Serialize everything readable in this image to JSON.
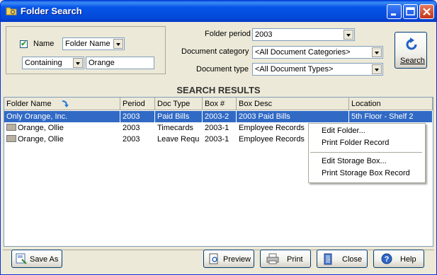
{
  "window": {
    "title": "Folder Search"
  },
  "filters": {
    "name_checkbox_label": "Name",
    "name_checked": true,
    "name_field_value": "Folder Name",
    "match_mode_value": "Containing",
    "search_text": "Orange",
    "folder_period_label": "Folder period",
    "folder_period_value": "2003",
    "document_category_label": "Document category",
    "document_category_value": "<All Document Categories>",
    "document_type_label": "Document type",
    "document_type_value": "<All Document Types>"
  },
  "search_button": {
    "label": "Search"
  },
  "results": {
    "title": "SEARCH RESULTS",
    "columns": [
      "Folder Name",
      "Period",
      "Doc Type",
      "Box #",
      "Box Desc",
      "Location"
    ],
    "rows": [
      {
        "folder_name": "Only Orange, Inc.",
        "period": "2003",
        "doc_type": "Paid Bills",
        "box": "2003-2",
        "box_desc": "2003 Paid Bills",
        "location": "5th Floor - Shelf 2",
        "selected": true
      },
      {
        "folder_name": "Orange, Ollie",
        "period": "2003",
        "doc_type": "Timecards",
        "box": "2003-1",
        "box_desc": "Employee Records",
        "location": "",
        "selected": false
      },
      {
        "folder_name": "Orange, Ollie",
        "period": "2003",
        "doc_type": "Leave Requ",
        "box": "2003-1",
        "box_desc": "Employee Records",
        "location": "",
        "selected": false
      }
    ]
  },
  "context_menu": {
    "items": [
      "Edit Folder...",
      "Print Folder Record",
      "Edit Storage Box...",
      "Print Storage Box Record"
    ]
  },
  "footer": {
    "save_as": "Save As",
    "preview": "Preview",
    "print": "Print",
    "close": "Close",
    "help": "Help"
  },
  "colors": {
    "titlebar": "#0449D9",
    "selection": "#316AC5",
    "window_bg": "#ECE9D8"
  },
  "icons": [
    "folder-search-icon",
    "minimize-icon",
    "maximize-icon",
    "close-icon",
    "refresh-icon",
    "sort-arrow-icon",
    "folder-icon",
    "save-as-icon",
    "preview-icon",
    "printer-icon",
    "close-door-icon",
    "help-icon"
  ]
}
